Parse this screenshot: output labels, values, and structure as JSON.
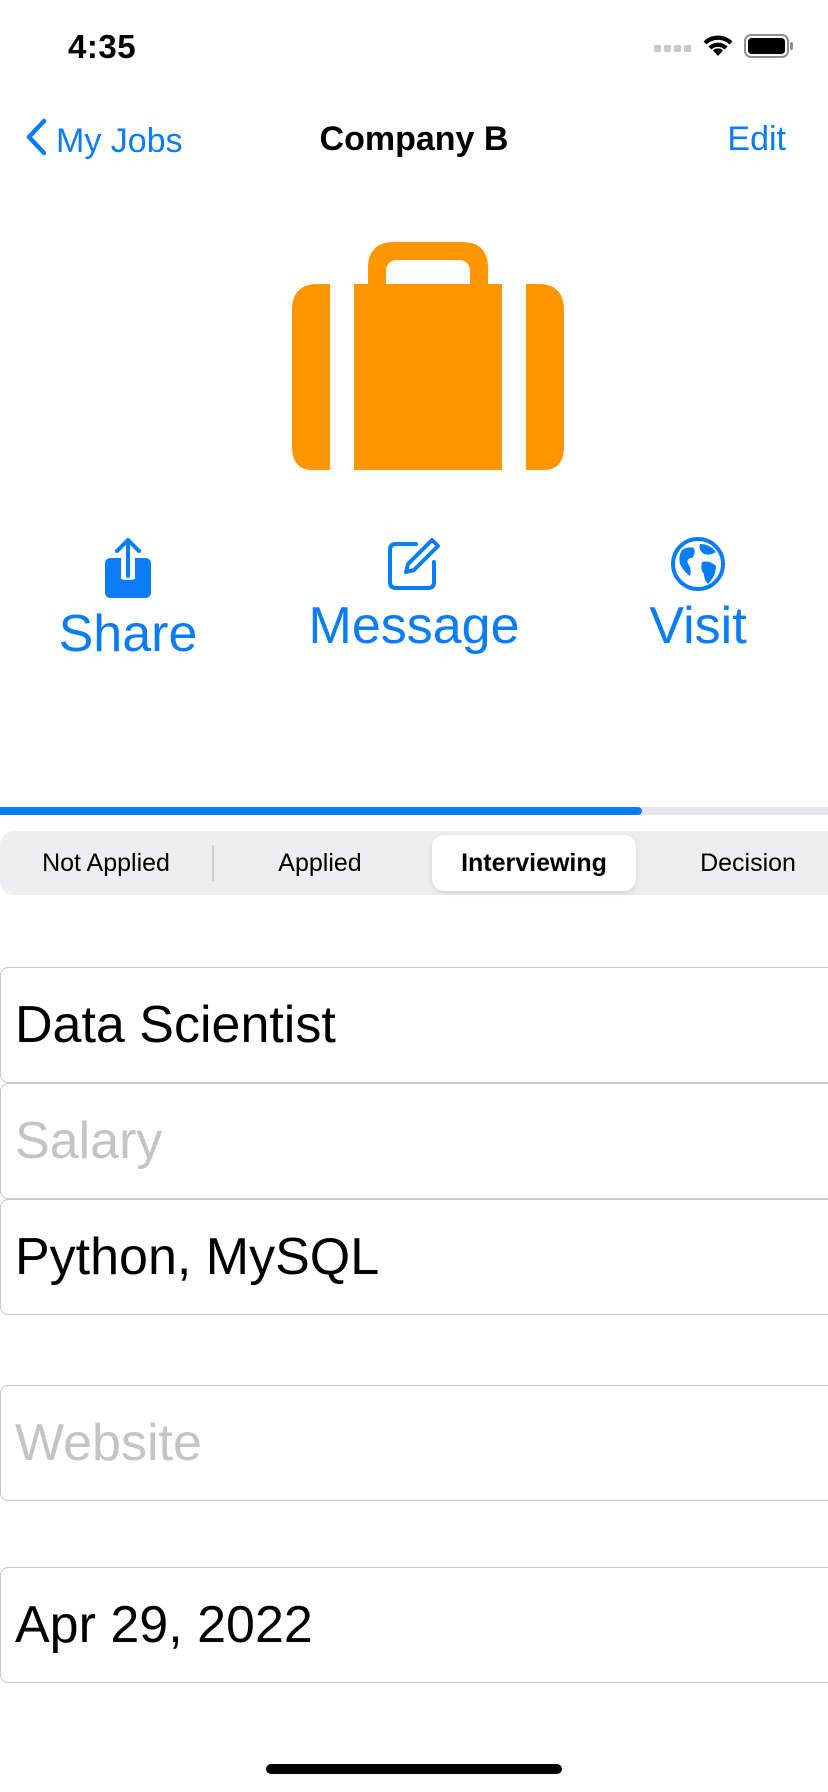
{
  "status_bar": {
    "time": "4:35",
    "icons": [
      "signal-icon",
      "wifi-icon",
      "battery-icon"
    ]
  },
  "nav": {
    "back_label": "My Jobs",
    "title": "Company B",
    "edit_label": "Edit"
  },
  "header_icon": {
    "name": "briefcase-icon",
    "color": "#FF9500"
  },
  "actions": {
    "share": {
      "label": "Share",
      "icon": "share-icon"
    },
    "message": {
      "label": "Message",
      "icon": "compose-icon"
    },
    "visit": {
      "label": "Visit",
      "icon": "globe-icon"
    }
  },
  "progress": {
    "value": 0.775
  },
  "status_segments": {
    "options": [
      "Not Applied",
      "Applied",
      "Interviewing",
      "Decision"
    ],
    "selected": "Interviewing"
  },
  "fields": {
    "position": {
      "value": "Data Scientist"
    },
    "salary": {
      "placeholder": "Salary"
    },
    "skills": {
      "value": "Python, MySQL"
    },
    "website": {
      "placeholder": "Website"
    },
    "date": {
      "value": "Apr 29, 2022"
    }
  },
  "colors": {
    "accent": "#0A7CF5",
    "briefcase": "#FF9500",
    "placeholder": "#C4C4C6"
  }
}
